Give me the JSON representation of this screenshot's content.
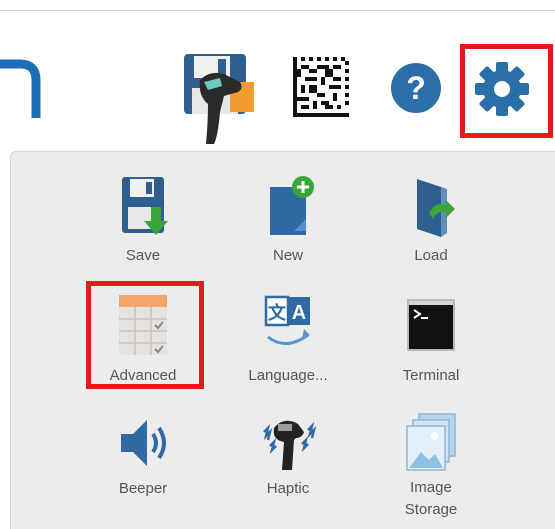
{
  "toolbar": {
    "icons": [
      "save-icon",
      "barcode-icon",
      "help-icon",
      "settings-icon"
    ],
    "help_glyph": "?"
  },
  "menu": {
    "items": [
      {
        "label": "Save",
        "icon": "save-icon"
      },
      {
        "label": "New",
        "icon": "new-file-icon"
      },
      {
        "label": "Load",
        "icon": "load-folder-icon"
      },
      {
        "label": "Advanced",
        "icon": "advanced-table-icon"
      },
      {
        "label": "Language...",
        "icon": "language-icon"
      },
      {
        "label": "Terminal",
        "icon": "terminal-icon"
      },
      {
        "label": "Beeper",
        "icon": "speaker-icon"
      },
      {
        "label": "Haptic",
        "icon": "haptic-scanner-icon"
      },
      {
        "label_line1": "Image",
        "label_line2": "Storage",
        "icon": "image-storage-icon"
      }
    ]
  },
  "colors": {
    "highlight": "#e21b1b",
    "brand_blue": "#1c6fb5",
    "settings_blue": "#2a6fa8",
    "panel_bg": "#ececec"
  }
}
